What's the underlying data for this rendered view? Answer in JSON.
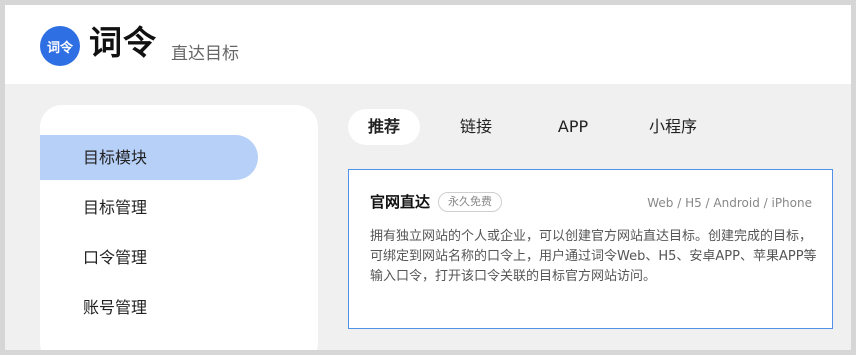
{
  "header": {
    "logo_text": "词令",
    "brand": "词令",
    "slogan": "直达目标"
  },
  "sidebar": {
    "items": [
      {
        "label": "目标模块",
        "active": true
      },
      {
        "label": "目标管理",
        "active": false
      },
      {
        "label": "口令管理",
        "active": false
      },
      {
        "label": "账号管理",
        "active": false
      }
    ]
  },
  "tabs": [
    {
      "label": "推荐",
      "active": true
    },
    {
      "label": "链接",
      "active": false
    },
    {
      "label": "APP",
      "active": false
    },
    {
      "label": "小程序",
      "active": false
    }
  ],
  "card": {
    "title": "官网直达",
    "badge": "永久免费",
    "platforms": "Web / H5 / Android / iPhone",
    "description": "拥有独立网站的个人或企业，可以创建官方网站直达目标。创建完成的目标，可绑定到网站名称的口令上，用户通过词令Web、H5、安卓APP、苹果APP等输入口令，打开该口令关联的目标官方网站访问。"
  },
  "colors": {
    "accent": "#2f6fe4",
    "active_sidebar": "#b6d0f8",
    "card_border": "#4f93e8"
  }
}
